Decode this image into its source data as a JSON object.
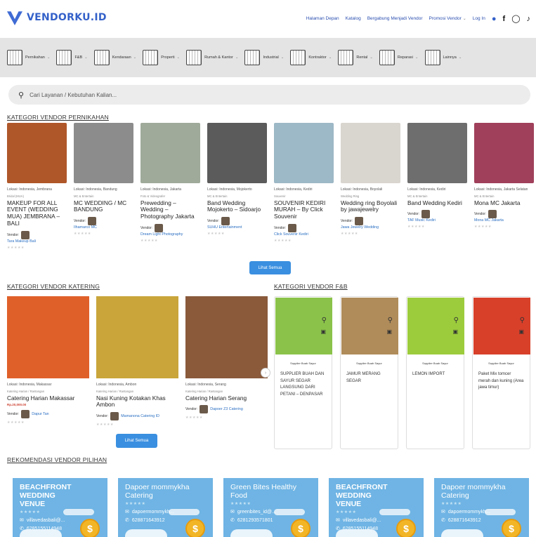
{
  "header": {
    "brand": "VENDORKU.ID",
    "nav": [
      {
        "label": "Halaman Depan",
        "dropdown": false
      },
      {
        "label": "Katalog",
        "dropdown": false
      },
      {
        "label": "Bergabung Menjadi Vendor",
        "dropdown": false
      },
      {
        "label": "Promosi Vendor",
        "dropdown": true
      },
      {
        "label": "Log In",
        "dropdown": false
      }
    ],
    "icons": [
      "user-icon",
      "facebook-icon",
      "instagram-icon",
      "tiktok-icon"
    ]
  },
  "categories": [
    {
      "label": "Pernikahan"
    },
    {
      "label": "F&B"
    },
    {
      "label": "Kendaraan"
    },
    {
      "label": "Properti"
    },
    {
      "label": "Rumah & Kantor"
    },
    {
      "label": "Industrial"
    },
    {
      "label": "Kontraktor"
    },
    {
      "label": "Rental"
    },
    {
      "label": "Reparasi"
    },
    {
      "label": "Lainnya"
    }
  ],
  "search": {
    "placeholder": "Cari Layanan / Kebutuhan Kalian..."
  },
  "wedding": {
    "title": "KATEGORI VENDOR PERNIKAHAN",
    "button": "Lihat Semua",
    "items": [
      {
        "location": "Lokasi: Indonesia, Jembrana",
        "sub": "Bridal (MUA)",
        "title": "MAKEUP FOR ALL EVENT (WEDDING MUA) JEMBRANA – BALI",
        "vendor_label": "Vendor:",
        "vendor": "Tara Makeup Bali",
        "color": "#b0572a"
      },
      {
        "location": "Lokasi: Indonesia, Bandung",
        "sub": "MC & Entertain",
        "title": "MC WEDDING / MC BANDUNG",
        "vendor_label": "Vendor:",
        "vendor": "Ilhamarco MC",
        "color": "#8c8c8c"
      },
      {
        "location": "Lokasi: Indonesia, Jakarta",
        "sub": "Foto & Videografer",
        "title": "Prewedding – Wedding – Photography Jakarta",
        "vendor_label": "Vendor:",
        "vendor": "Dream Light Photography",
        "color": "#9faa9a"
      },
      {
        "location": "Lokasi: Indonesia, Mojokerto",
        "sub": "MC & Entertain",
        "title": "Band Wedding Mojokerto – Sidoarjo",
        "vendor_label": "Vendor:",
        "vendor": "SUHU Entertainment",
        "color": "#5b5b5b"
      },
      {
        "location": "Lokasi: Indonesia, Kediri",
        "sub": "Souvenir",
        "title": "SOUVENIR KEDIRI MURAH – By Click Souvenir",
        "vendor_label": "Vendor:",
        "vendor": "Click Souvenir Kediri",
        "color": "#9db8c6"
      },
      {
        "location": "Lokasi: Indonesia, Boyolali",
        "sub": "Wedding Ring",
        "title": "Wedding ring Boyolali by jawajewelry",
        "vendor_label": "Vendor:",
        "vendor": "Jawa Jewelry Wedding",
        "color": "#d9d5cf"
      },
      {
        "location": "Lokasi: Indonesia, Kediri",
        "sub": "MC & Entertain",
        "title": "Band Wedding Kediri",
        "vendor_label": "Vendor:",
        "vendor": "TAF Music Kediri",
        "color": "#6e6e6e"
      },
      {
        "location": "Lokasi: Indonesia, Jakarta Selatan",
        "sub": "MC & Entertain",
        "title": "Mona MC Jakarta",
        "vendor_label": "Vendor:",
        "vendor": "Mona MC Jakarta",
        "color": "#a0405a"
      }
    ]
  },
  "catering": {
    "title": "KATEGORI VENDOR KATERING",
    "button": "Lihat Semua",
    "items": [
      {
        "location": "Lokasi: Indonesia, Makassar",
        "sub": "Katering Harian / Rantangan",
        "title": "Catering Harian Makassar",
        "price": "Rp.20,000.00",
        "vendor_label": "Vendor:",
        "vendor": "Dapur Tan",
        "color": "#e0602a"
      },
      {
        "location": "Lokasi: Indonesia, Ambon",
        "sub": "Katering Harian / Rantangan",
        "title": "Nasi Kuning Kotakan Khas Ambon",
        "price": "",
        "vendor_label": "Vendor:",
        "vendor": "Mamanona Catering ID",
        "color": "#c9a53a"
      },
      {
        "location": "Lokasi: Indonesia, Serang",
        "sub": "Katering Harian / Rantangan",
        "title": "Catering Harian Serang",
        "price": "",
        "vendor_label": "Vendor:",
        "vendor": "Dapoer Z3 Catering",
        "color": "#8a5a3b"
      }
    ]
  },
  "fnb": {
    "title": "KATEGORI VENDOR F&B",
    "items": [
      {
        "sub": "Supplier Buah Sayur",
        "title": "SUPPLIER BUAH DAN SAYUR SEGAR LANGSUNG DARI PETANI – DENPASAR",
        "upper": true,
        "color": "#8bc34a"
      },
      {
        "sub": "Supplier Buah Sayur",
        "title": "JAMUR MERANG SEGAR",
        "upper": true,
        "color": "#b08c5a"
      },
      {
        "sub": "Supplier Buah Sayur",
        "title": "LEMON IMPORT",
        "upper": true,
        "color": "#9ccc3c"
      },
      {
        "sub": "Supplier Buah Sayur",
        "title": "Paket Mix tomcer merah dan kuning (Area jawa timur)",
        "upper": false,
        "color": "#d8402a"
      }
    ]
  },
  "recommend": {
    "title": "REKOMENDASI VENDOR PILIHAN",
    "items": [
      {
        "name": "BEACHFRONT WEDDING\nVENUE",
        "upper": true,
        "email": "villavedasbali@...",
        "phone": "6285155114948"
      },
      {
        "name": "Dapoer mommykha\nCatering",
        "upper": false,
        "email": "dapoermommykh...",
        "phone": "628871643912"
      },
      {
        "name": "Green Bites Healthy\nFood",
        "upper": false,
        "email": "greenbites_id@...",
        "phone": "6281293571801"
      },
      {
        "name": "BEACHFRONT WEDDING\nVENUE",
        "upper": true,
        "email": "villavedasbali@...",
        "phone": "6285155114948"
      },
      {
        "name": "Dapoer mommykha\nCatering",
        "upper": false,
        "email": "dapoermommykh...",
        "phone": "628871643912"
      }
    ]
  }
}
